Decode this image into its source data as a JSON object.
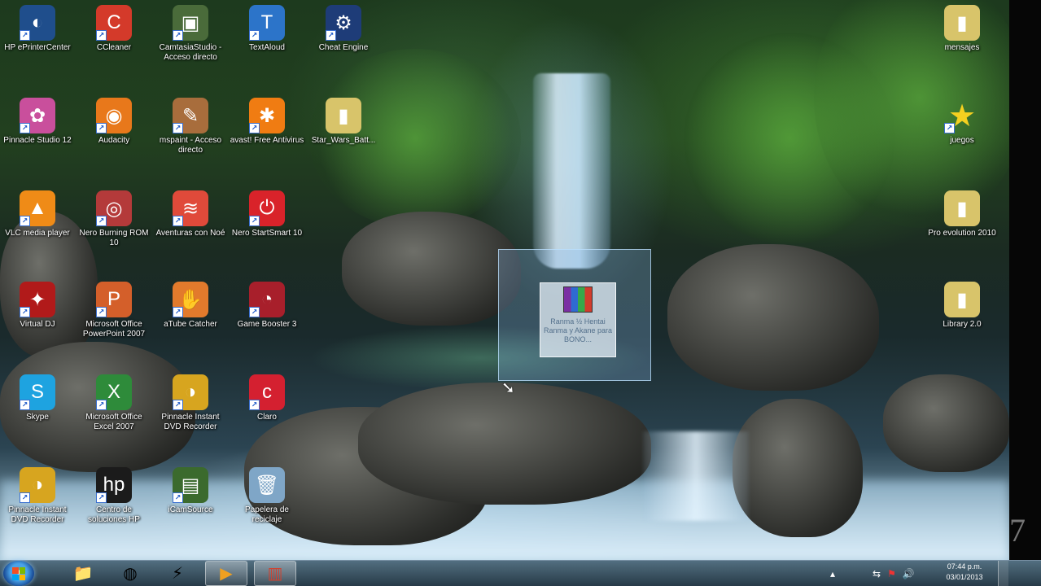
{
  "desktop": {
    "icons": [
      {
        "label": "HP ePrinterCenter",
        "glyph": "◐",
        "bg": "#1f4e8c"
      },
      {
        "label": "CCleaner",
        "glyph": "C",
        "bg": "#d43a2a"
      },
      {
        "label": "CamtasiaStudio - Acceso directo",
        "glyph": "▣",
        "bg": "#4a6b3a"
      },
      {
        "label": "TextAloud",
        "glyph": "T",
        "bg": "#2c74c9"
      },
      {
        "label": "Cheat Engine",
        "glyph": "⚙",
        "bg": "#1e3c78"
      },
      {
        "label": "Pinnacle Studio 12",
        "glyph": "✿",
        "bg": "#c94f9c"
      },
      {
        "label": "Audacity",
        "glyph": "◉",
        "bg": "#e8781b"
      },
      {
        "label": "mspaint - Acceso directo",
        "glyph": "✎",
        "bg": "#a86d3c"
      },
      {
        "label": "avast! Free Antivirus",
        "glyph": "✱",
        "bg": "#f07c12"
      },
      {
        "label": "Star_Wars_Batt...",
        "glyph": "▮",
        "bg": "#d8c46a"
      },
      {
        "label": "VLC media player",
        "glyph": "▲",
        "bg": "#ef8b17"
      },
      {
        "label": "Nero Burning ROM 10",
        "glyph": "◎",
        "bg": "#b43a3a"
      },
      {
        "label": "Aventuras con Noé",
        "glyph": "≋",
        "bg": "#e04a3a"
      },
      {
        "label": "Nero StartSmart 10",
        "glyph": "⏻",
        "bg": "#d9232a"
      },
      {
        "label": "Virtual DJ",
        "glyph": "✦",
        "bg": "#b11a1a"
      },
      {
        "label": "Microsoft Office PowerPoint 2007",
        "glyph": "P",
        "bg": "#d45f2a"
      },
      {
        "label": "aTube Catcher",
        "glyph": "✋",
        "bg": "#e27a2c"
      },
      {
        "label": "Game Booster 3",
        "glyph": "◔",
        "bg": "#a81f2b"
      },
      {
        "label": "Skype",
        "glyph": "S",
        "bg": "#1ea3e0"
      },
      {
        "label": "Microsoft Office Excel 2007",
        "glyph": "X",
        "bg": "#2e8b3a"
      },
      {
        "label": "Pinnacle Instant DVD Recorder",
        "glyph": "◑",
        "bg": "#d7a51f"
      },
      {
        "label": "Claro",
        "glyph": "c",
        "bg": "#d42030"
      },
      {
        "label": "Pinnacle Instant DVD Recorder",
        "glyph": "◑",
        "bg": "#d7a51f"
      },
      {
        "label": "Centro de soluciones HP",
        "glyph": "hp",
        "bg": "#1b1b1b"
      },
      {
        "label": "iCamSource",
        "glyph": "▤",
        "bg": "#3b6a2d"
      },
      {
        "label": "Papelera de reciclaje",
        "glyph": "🗑",
        "bg": "#7fa6c7"
      },
      {
        "label": "mensajes",
        "glyph": "▮",
        "bg": "#d8c46a"
      },
      {
        "label": "juegos",
        "glyph": "★",
        "bg": "transparent"
      },
      {
        "label": "Pro evolution 2010",
        "glyph": "▮",
        "bg": "#d8c46a"
      },
      {
        "label": "Library 2.0",
        "glyph": "▮",
        "bg": "#d8c46a"
      }
    ],
    "dragging_label": "Ranma ½ Hentai Ranma y Akane para BONO..."
  },
  "taskbar": {
    "start_label": "Start",
    "pinned": [
      "📁",
      "◍",
      "⚡",
      "▶",
      "▥"
    ],
    "tray_glyphs": [
      "▴",
      "⇆",
      "⚑",
      "🔊"
    ],
    "time": "07:44 p.m.",
    "date": "03/01/2013"
  }
}
